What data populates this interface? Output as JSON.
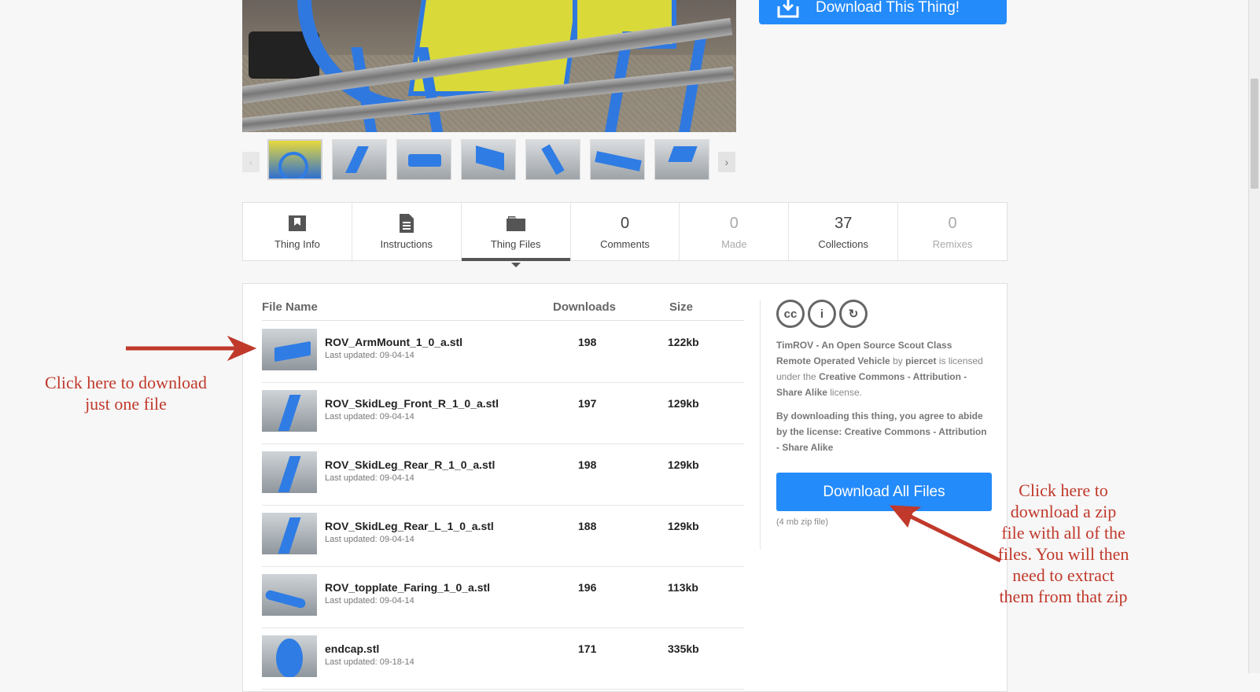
{
  "header": {
    "download_thing_label": "Download This Thing!"
  },
  "tabs": [
    {
      "label": "Thing Info",
      "icon": "thing-info-icon"
    },
    {
      "label": "Instructions",
      "icon": "instructions-icon"
    },
    {
      "label": "Thing Files",
      "icon": "thing-files-icon",
      "active": true
    },
    {
      "label": "Comments",
      "count": "0"
    },
    {
      "label": "Made",
      "count": "0"
    },
    {
      "label": "Collections",
      "count": "37"
    },
    {
      "label": "Remixes",
      "count": "0"
    }
  ],
  "files": {
    "columns": {
      "name": "File Name",
      "downloads": "Downloads",
      "size": "Size"
    },
    "rows": [
      {
        "name": "ROV_ArmMount_1_0_a.stl",
        "date": "Last updated: 09-04-14",
        "downloads": "198",
        "size": "122kb"
      },
      {
        "name": "ROV_SkidLeg_Front_R_1_0_a.stl",
        "date": "Last updated: 09-04-14",
        "downloads": "197",
        "size": "129kb"
      },
      {
        "name": "ROV_SkidLeg_Rear_R_1_0_a.stl",
        "date": "Last updated: 09-04-14",
        "downloads": "198",
        "size": "129kb"
      },
      {
        "name": "ROV_SkidLeg_Rear_L_1_0_a.stl",
        "date": "Last updated: 09-04-14",
        "downloads": "188",
        "size": "129kb"
      },
      {
        "name": "ROV_topplate_Faring_1_0_a.stl",
        "date": "Last updated: 09-04-14",
        "downloads": "196",
        "size": "113kb"
      },
      {
        "name": "endcap.stl",
        "date": "Last updated: 09-18-14",
        "downloads": "171",
        "size": "335kb"
      }
    ]
  },
  "license": {
    "cc_glyphs": [
      "cc",
      "i",
      "↻"
    ],
    "thing_title": "TimROV - An Open Source Scout Class Remote Operated Vehicle",
    "by": "by",
    "author": "piercet",
    "licensed_text": "is licensed under the",
    "license_name": "Creative Commons - Attribution - Share Alike",
    "license_suffix": "license.",
    "agree_text": "By downloading this thing, you agree to abide by the license: Creative Commons - Attribution - Share Alike"
  },
  "download_all": {
    "label": "Download All Files",
    "note": "(4 mb zip file)"
  },
  "annotations": {
    "one_file": "Click here to download just one file",
    "zip_file": "Click here to download a zip file with all of the files. You will then need to extract them from that zip"
  },
  "colors": {
    "accent": "#248bfb",
    "annotation": "#c0392b"
  }
}
